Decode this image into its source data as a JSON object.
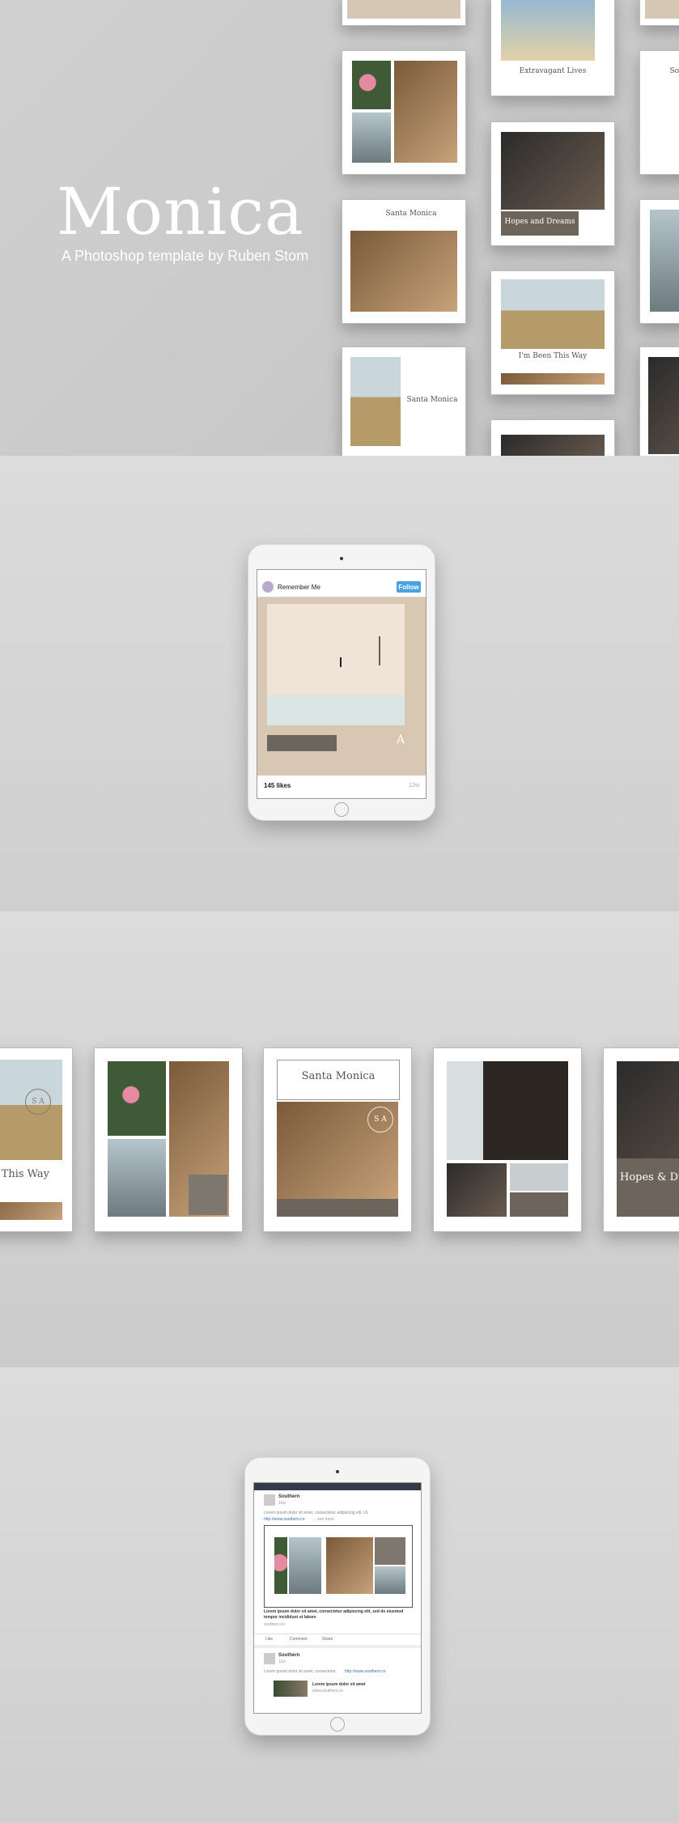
{
  "hero": {
    "title": "Monica",
    "subtitle": "A Photoshop template by Ruben Stom"
  },
  "grid_cards": {
    "extravagant": "Extravagant Lives",
    "hopes": "Hopes and Dreams",
    "santa": "Santa Monica",
    "been": "I'm Been This Way",
    "santa2": "Santa Monica",
    "edge": "Soo"
  },
  "instagram": {
    "username": "Remember Me",
    "follow_label": "Follow",
    "likes": "145 likes",
    "time": "12w",
    "seal_letter": "A"
  },
  "row_cards": {
    "this_way": "This Way",
    "santa": "Santa Monica",
    "hopes": "Hopes & Drea"
  },
  "facebook": {
    "post1_name": "Southern",
    "post1_time": "11w",
    "post1_text": "Lorem ipsum dolor sit amet, consectetur adipiscing elit. Ut.",
    "post1_link": "http://www.southern.co",
    "post1_more": "...see more",
    "post1_caption": "Lorem ipsum dolor sit amet, consectetur adipiscing elit, sed do eiusmod tempor incididunt ut labore",
    "post1_domain": "southern.co",
    "actions": [
      "Like",
      "Comment",
      "Share"
    ],
    "post2_name": "Southern",
    "post2_time": "11w",
    "post2_text": "Lorem ipsum dolor sit amet, consectetur.",
    "post2_link": "http://www.southern.co",
    "post2_title": "Lorem ipsum dolor sit amet",
    "post2_domain": "www.southern.co"
  }
}
